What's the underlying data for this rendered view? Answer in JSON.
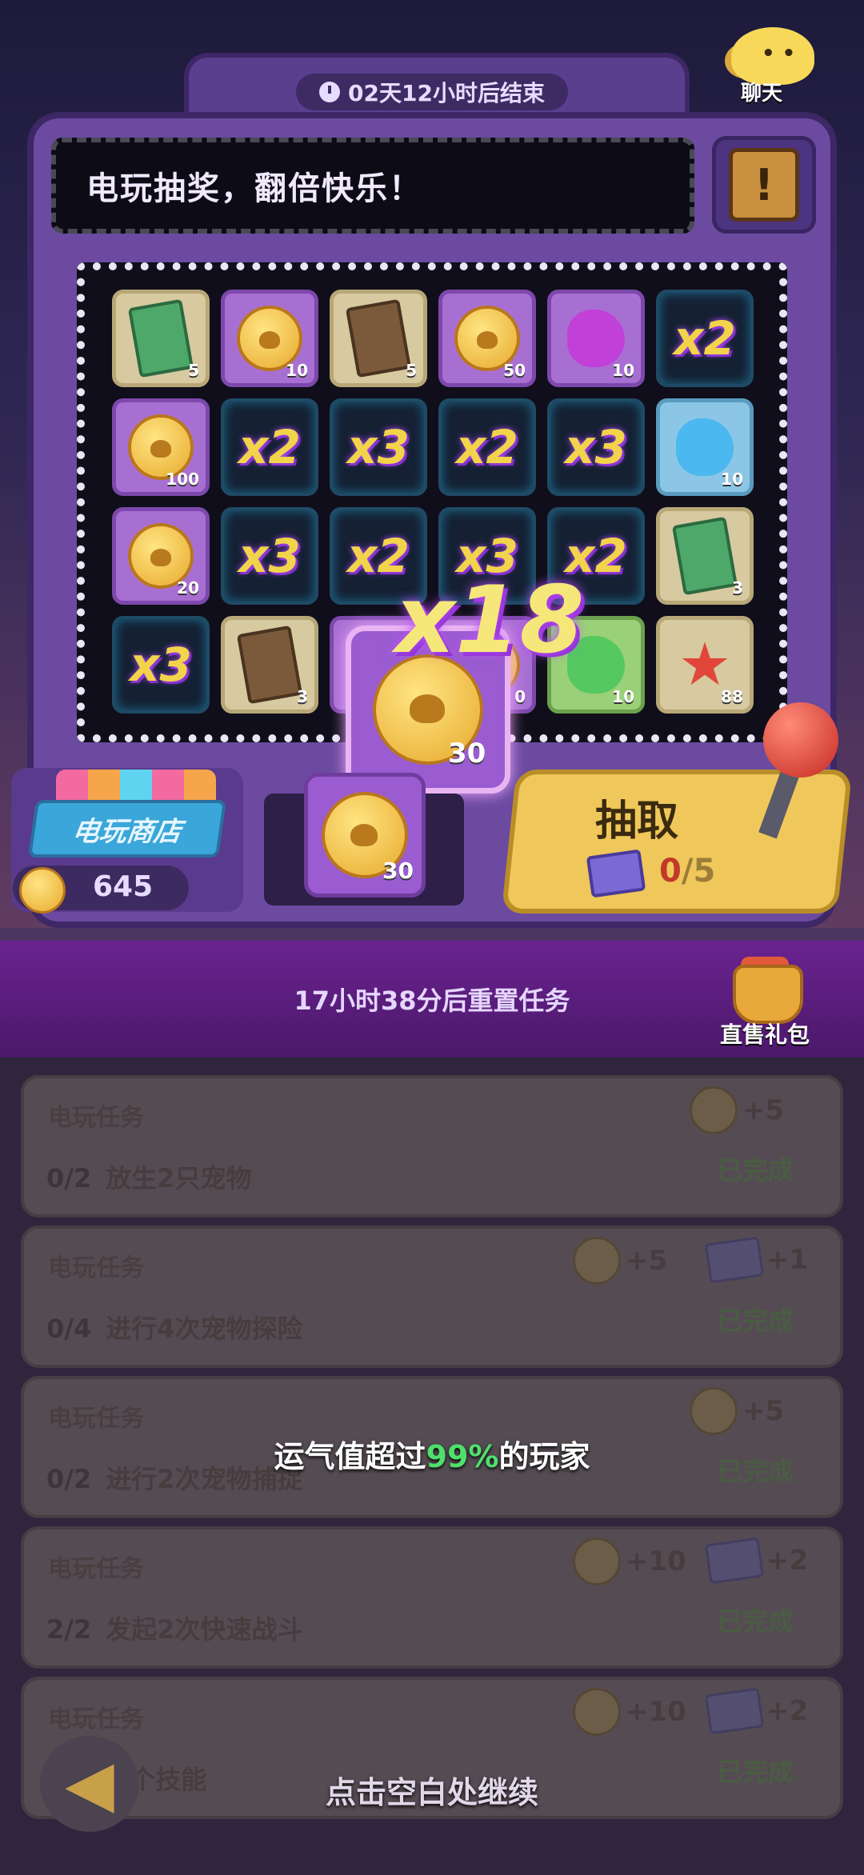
{
  "header": {
    "timer": "02天12小时后结束",
    "chat_label": "聊天",
    "marquee_text": "电玩抽奖，翻倍快乐！",
    "info_symbol": "!"
  },
  "grid": {
    "rows": [
      [
        {
          "kind": "item",
          "icon": "green-ticket-icon",
          "count": "5"
        },
        {
          "kind": "item",
          "icon": "paw-coin-icon",
          "count": "10",
          "style": "purple"
        },
        {
          "kind": "item",
          "icon": "brown-ticket-icon",
          "count": "5"
        },
        {
          "kind": "item",
          "icon": "paw-coin-icon",
          "count": "50",
          "style": "purple"
        },
        {
          "kind": "item",
          "icon": "purple-potion-icon",
          "count": "10",
          "style": "purple"
        },
        {
          "kind": "mult",
          "label": "x2"
        }
      ],
      [
        {
          "kind": "item",
          "icon": "paw-coin-icon",
          "count": "100",
          "style": "purple"
        },
        {
          "kind": "mult",
          "label": "x2"
        },
        {
          "kind": "mult",
          "label": "x3"
        },
        {
          "kind": "mult",
          "label": "x2"
        },
        {
          "kind": "mult",
          "label": "x3"
        },
        {
          "kind": "item",
          "icon": "blue-potion-icon",
          "count": "10",
          "style": "blue"
        }
      ],
      [
        {
          "kind": "item",
          "icon": "paw-coin-icon",
          "count": "20",
          "style": "purple"
        },
        {
          "kind": "mult",
          "label": "x3"
        },
        {
          "kind": "mult",
          "label": "x2"
        },
        {
          "kind": "mult",
          "label": "x3"
        },
        {
          "kind": "mult",
          "label": "x2"
        },
        {
          "kind": "item",
          "icon": "green-ticket-icon",
          "count": "3"
        }
      ],
      [
        {
          "kind": "mult",
          "label": "x3"
        },
        {
          "kind": "item",
          "icon": "brown-ticket-icon",
          "count": "3"
        },
        {
          "kind": "item",
          "icon": "paw-coin-icon",
          "count": "",
          "style": "purple"
        },
        {
          "kind": "item",
          "icon": "paw-coin-icon",
          "count": "0",
          "style": "purple"
        },
        {
          "kind": "item",
          "icon": "green-potion-icon",
          "count": "10",
          "style": "green"
        },
        {
          "kind": "item",
          "icon": "starfish-icon",
          "count": "88"
        }
      ]
    ]
  },
  "reward_popup": {
    "multiplier": "x18",
    "count": "30"
  },
  "machine_bottom": {
    "shop_label": "电玩商店",
    "coins": "645",
    "slot_count": "30",
    "draw_label": "抽取",
    "draw_count_current": "0",
    "draw_count_total": "/5"
  },
  "banner": {
    "reset_text": "17小时38分后重置任务",
    "gift_label": "直售礼包"
  },
  "tasks": [
    {
      "title": "电玩任务",
      "progress": "0/2",
      "desc": "放生2只宠物",
      "coin_reward": "+5",
      "ticket_reward": "",
      "status": "已完成"
    },
    {
      "title": "电玩任务",
      "progress": "0/4",
      "desc": "进行4次宠物探险",
      "coin_reward": "+5",
      "ticket_reward": "+1",
      "status": "已完成"
    },
    {
      "title": "电玩任务",
      "progress": "0/2",
      "desc": "进行2次宠物捕捉",
      "coin_reward": "+5",
      "ticket_reward": "",
      "status": "已完成"
    },
    {
      "title": "电玩任务",
      "progress": "2/2",
      "desc": "发起2次快速战斗",
      "coin_reward": "+10",
      "ticket_reward": "+2",
      "status": "已完成"
    },
    {
      "title": "电玩任务",
      "progress": "",
      "desc": "抽取2个技能",
      "coin_reward": "+10",
      "ticket_reward": "+2",
      "status": "已完成"
    }
  ],
  "overlay": {
    "luck_prefix": "运气值超过",
    "luck_pct": "99%",
    "luck_suffix": "的玩家",
    "continue_text": "点击空白处继续"
  },
  "colors": {
    "luck_pct": "#4fe06c",
    "draw_button": "#f0c75a",
    "banner": "#6a2390"
  }
}
